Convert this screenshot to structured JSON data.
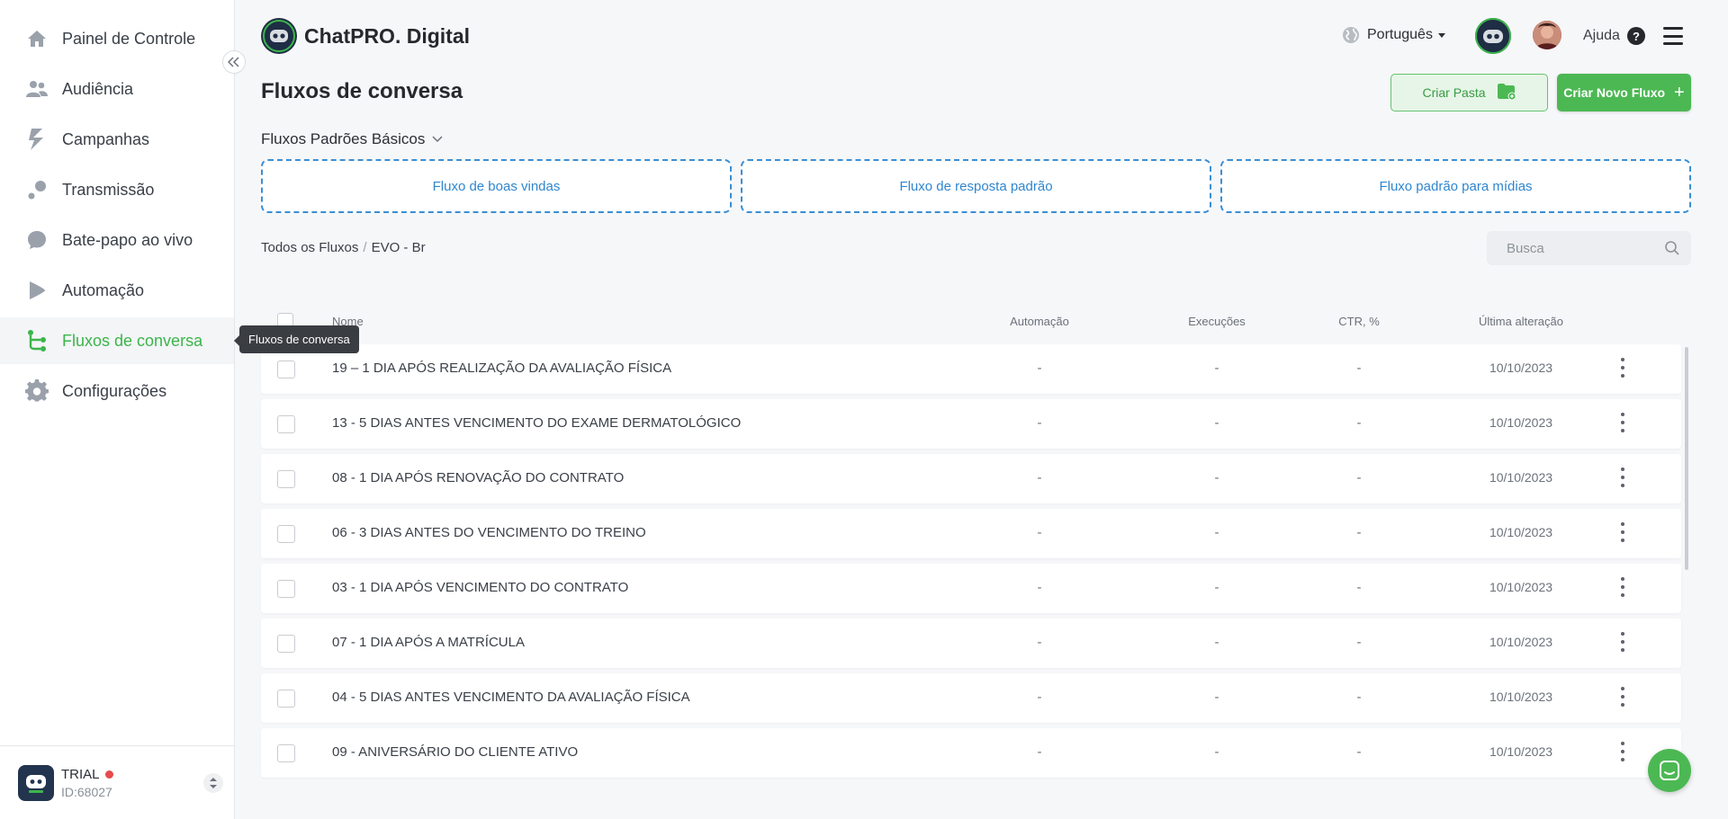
{
  "sidebar": {
    "items": [
      {
        "label": "Painel de Controle",
        "icon": "home-icon"
      },
      {
        "label": "Audiência",
        "icon": "users-icon"
      },
      {
        "label": "Campanhas",
        "icon": "lightning-icon"
      },
      {
        "label": "Transmissão",
        "icon": "broadcast-icon"
      },
      {
        "label": "Bate-papo ao vivo",
        "icon": "chat-bubble-icon"
      },
      {
        "label": "Automação",
        "icon": "play-icon"
      },
      {
        "label": "Fluxos de conversa",
        "icon": "flow-icon",
        "active": true
      },
      {
        "label": "Configurações",
        "icon": "gear-icon"
      }
    ],
    "tooltip": "Fluxos de conversa",
    "account": {
      "plan": "TRIAL",
      "id": "ID:68027"
    }
  },
  "header": {
    "brand": "ChatPRO. Digital",
    "language": "Português",
    "help": "Ajuda",
    "help_icon": "?"
  },
  "page": {
    "title": "Fluxos de conversa",
    "create_folder": "Criar Pasta",
    "create_flow": "Criar Novo Fluxo",
    "create_flow_icon": "+"
  },
  "defaults": {
    "title": "Fluxos Padrões Básicos",
    "cards": [
      "Fluxo de boas vindas",
      "Fluxo de resposta padrão",
      "Fluxo padrão para mídias"
    ]
  },
  "breadcrumb": {
    "root": "Todos os Fluxos",
    "separator": "/",
    "current": "EVO - Br"
  },
  "search": {
    "placeholder": "Busca"
  },
  "table": {
    "columns": {
      "name": "Nome",
      "automation": "Automação",
      "executions": "Execuções",
      "ctr": "CTR, %",
      "updated": "Última alteração"
    },
    "rows": [
      {
        "name": "19 – 1 DIA APÓS REALIZAÇÃO DA AVALIAÇÃO FÍSICA",
        "automation": "-",
        "executions": "-",
        "ctr": "-",
        "updated": "10/10/2023"
      },
      {
        "name": "13 - 5 DIAS ANTES VENCIMENTO DO EXAME DERMATOLÓGICO",
        "automation": "-",
        "executions": "-",
        "ctr": "-",
        "updated": "10/10/2023"
      },
      {
        "name": "08 - 1 DIA APÓS RENOVAÇÃO DO CONTRATO",
        "automation": "-",
        "executions": "-",
        "ctr": "-",
        "updated": "10/10/2023"
      },
      {
        "name": "06 - 3 DIAS ANTES DO VENCIMENTO DO TREINO",
        "automation": "-",
        "executions": "-",
        "ctr": "-",
        "updated": "10/10/2023"
      },
      {
        "name": "03 - 1 DIA APÓS VENCIMENTO DO CONTRATO",
        "automation": "-",
        "executions": "-",
        "ctr": "-",
        "updated": "10/10/2023"
      },
      {
        "name": "07 - 1 DIA APÓS A MATRÍCULA",
        "automation": "-",
        "executions": "-",
        "ctr": "-",
        "updated": "10/10/2023"
      },
      {
        "name": "04 - 5 DIAS ANTES VENCIMENTO DA AVALIAÇÃO FÍSICA",
        "automation": "-",
        "executions": "-",
        "ctr": "-",
        "updated": "10/10/2023"
      },
      {
        "name": "09 - ANIVERSÁRIO DO CLIENTE ATIVO",
        "automation": "-",
        "executions": "-",
        "ctr": "-",
        "updated": "10/10/2023"
      }
    ]
  },
  "colors": {
    "accent": "#4cb853",
    "link": "#2f86cf",
    "tooltip_bg": "#3a3d42"
  }
}
